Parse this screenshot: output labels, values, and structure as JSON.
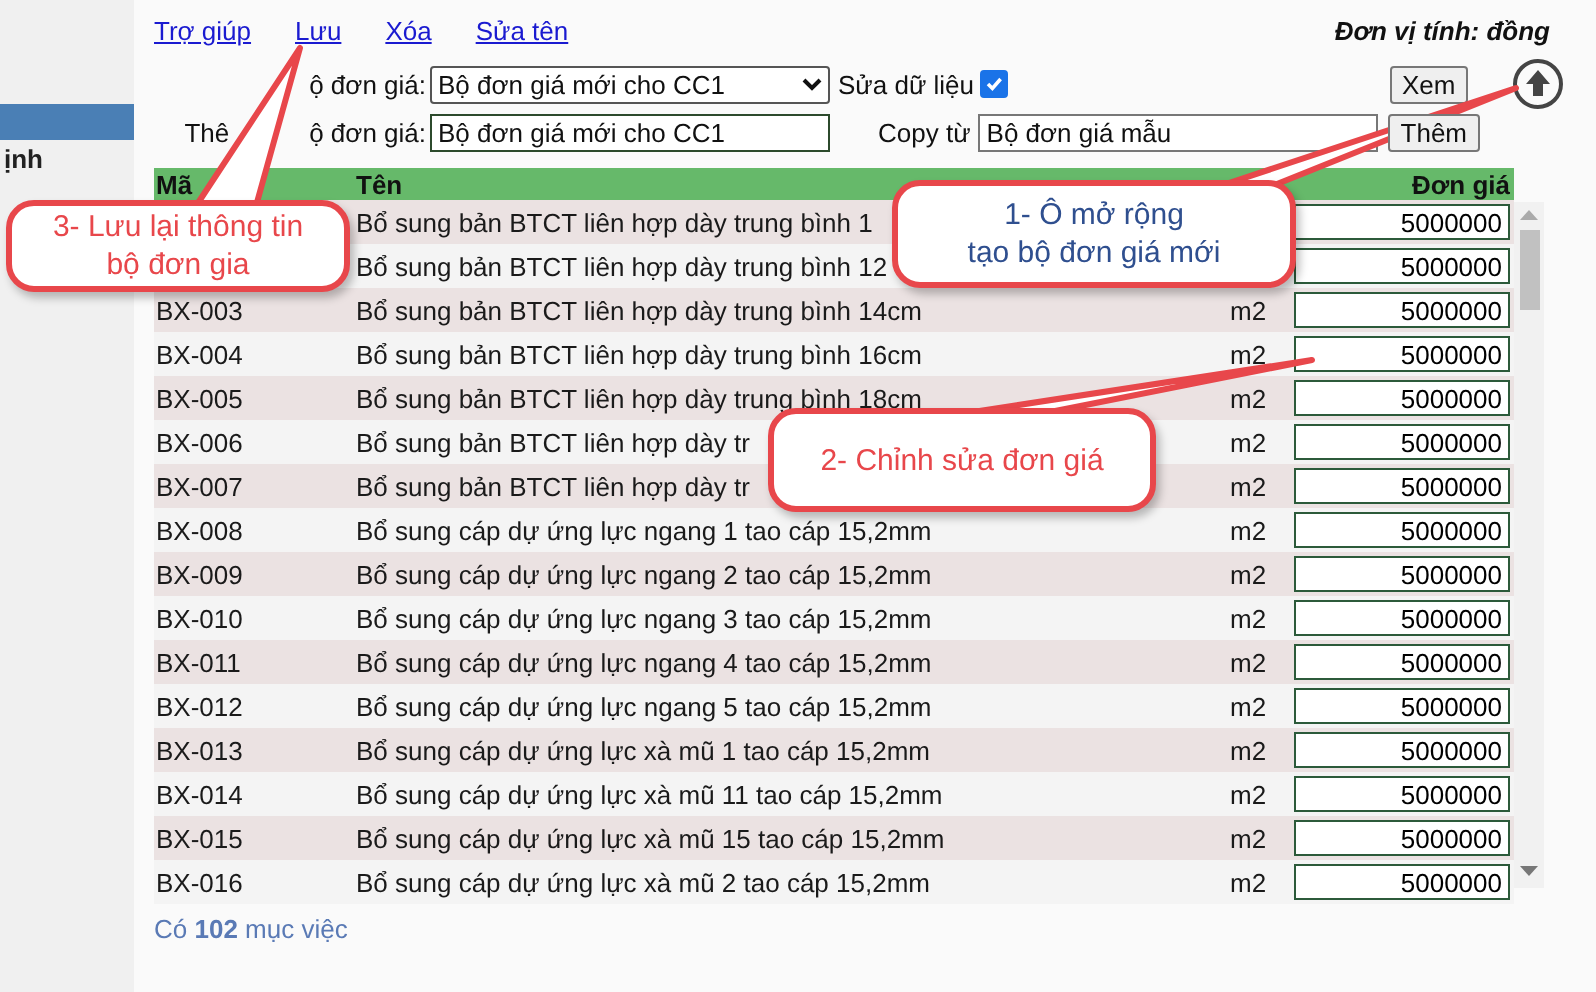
{
  "sidebar": {
    "items": [
      {
        "selected": true
      },
      {
        "label": "ịnh",
        "selected": false
      }
    ]
  },
  "links": [
    {
      "label": "Trợ giúp"
    },
    {
      "label": "Lưu"
    },
    {
      "label": "Xóa"
    },
    {
      "label": "Sửa tên"
    }
  ],
  "unit_note": "Đơn vị tính: đồng",
  "form": {
    "price_set_label": "ộ đơn giá:",
    "price_set_value": "Bộ đơn giá mới cho CC1",
    "edit_label": "Sửa dữ liệu",
    "edit_checked": true,
    "view_button": "Xem",
    "new_label_parts": [
      "Thê",
      "ộ đơn giá:"
    ],
    "new_value": "Bộ đơn giá mới cho CC1",
    "copy_label": "Copy từ",
    "copy_value": "Bộ đơn giá mẫu",
    "add_button": "Thêm"
  },
  "table": {
    "header": {
      "code": "Mã",
      "name": "Tên",
      "price": "Đơn giá"
    },
    "rows": [
      {
        "name": "Bổ sung bản BTCT liên hợp dày trung bình 1",
        "price": "5000000"
      },
      {
        "name": "Bổ sung bản BTCT liên hợp dày trung bình 12",
        "price": "5000000"
      },
      {
        "code": "BX-003",
        "name": "Bổ sung bản BTCT liên hợp dày trung bình 14cm",
        "unit": "m2",
        "price": "5000000"
      },
      {
        "code": "BX-004",
        "name": "Bổ sung bản BTCT liên hợp dày trung bình 16cm",
        "unit": "m2",
        "price": "5000000"
      },
      {
        "code": "BX-005",
        "name": "Bổ sung bản BTCT liên hợp dày trung bình 18cm",
        "unit": "m2",
        "price": "5000000"
      },
      {
        "code": "BX-006",
        "name": "Bổ sung bản BTCT liên hợp dày tr",
        "unit": "m2",
        "price": "5000000"
      },
      {
        "code": "BX-007",
        "name": "Bổ sung bản BTCT liên hợp dày tr",
        "unit": "m2",
        "price": "5000000"
      },
      {
        "code": "BX-008",
        "name": "Bổ sung cáp dự ứng lực ngang 1 tao cáp 15,2mm",
        "unit": "m2",
        "price": "5000000"
      },
      {
        "code": "BX-009",
        "name": "Bổ sung cáp dự ứng lực ngang 2 tao cáp 15,2mm",
        "unit": "m2",
        "price": "5000000"
      },
      {
        "code": "BX-010",
        "name": "Bổ sung cáp dự ứng lực ngang 3 tao cáp 15,2mm",
        "unit": "m2",
        "price": "5000000"
      },
      {
        "code": "BX-011",
        "name": "Bổ sung cáp dự ứng lực ngang 4 tao cáp 15,2mm",
        "unit": "m2",
        "price": "5000000"
      },
      {
        "code": "BX-012",
        "name": "Bổ sung cáp dự ứng lực ngang 5 tao cáp 15,2mm",
        "unit": "m2",
        "price": "5000000"
      },
      {
        "code": "BX-013",
        "name": "Bổ sung cáp dự ứng lực xà mũ 1 tao cáp 15,2mm",
        "unit": "m2",
        "price": "5000000"
      },
      {
        "code": "BX-014",
        "name": "Bổ sung cáp dự ứng lực xà mũ 11 tao cáp 15,2mm",
        "unit": "m2",
        "price": "5000000"
      },
      {
        "code": "BX-015",
        "name": "Bổ sung cáp dự ứng lực xà mũ 15 tao cáp 15,2mm",
        "unit": "m2",
        "price": "5000000"
      },
      {
        "code": "BX-016",
        "name": "Bổ sung cáp dự ứng lực xà mũ 2 tao cáp 15,2mm",
        "unit": "m2",
        "price": "5000000"
      }
    ]
  },
  "footer": "Có **102** mục việc",
  "callouts": [
    {
      "text": "3- Lưu lại thông tin",
      "text2": "bộ đơn gia",
      "color": "#e8474b"
    },
    {
      "text": "1- Ô mở rộng",
      "text2": "tạo bộ đơn giá mới",
      "color": "#2f4f8f"
    },
    {
      "text": "2- Chỉnh sửa đơn giá",
      "color": "#e8474b"
    }
  ]
}
